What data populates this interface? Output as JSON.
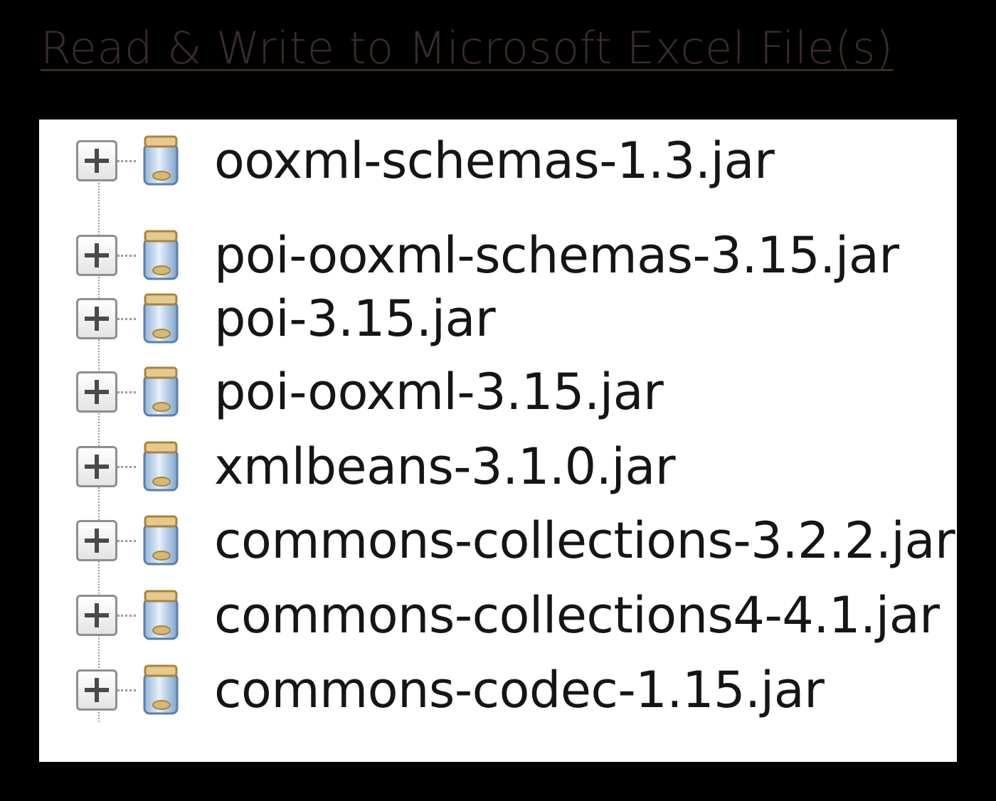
{
  "title": "Read & Write to Microsoft Excel File(s)",
  "tree": {
    "items": [
      {
        "label": "ooxml-schemas-1.3.jar"
      },
      {
        "label": "poi-ooxml-schemas-3.15.jar"
      },
      {
        "label": "poi-3.15.jar"
      },
      {
        "label": "poi-ooxml-3.15.jar"
      },
      {
        "label": "xmlbeans-3.1.0.jar"
      },
      {
        "label": "commons-collections-3.2.2.jar"
      },
      {
        "label": "commons-collections4-4.1.jar"
      },
      {
        "label": "commons-codec-1.15.jar"
      }
    ]
  },
  "icons": {
    "expander": "expand-plus-icon",
    "item": "jar-file-icon"
  },
  "colors": {
    "background": "#000000",
    "panel": "#ffffff",
    "title": "#3a2a33",
    "text": "#151515"
  }
}
